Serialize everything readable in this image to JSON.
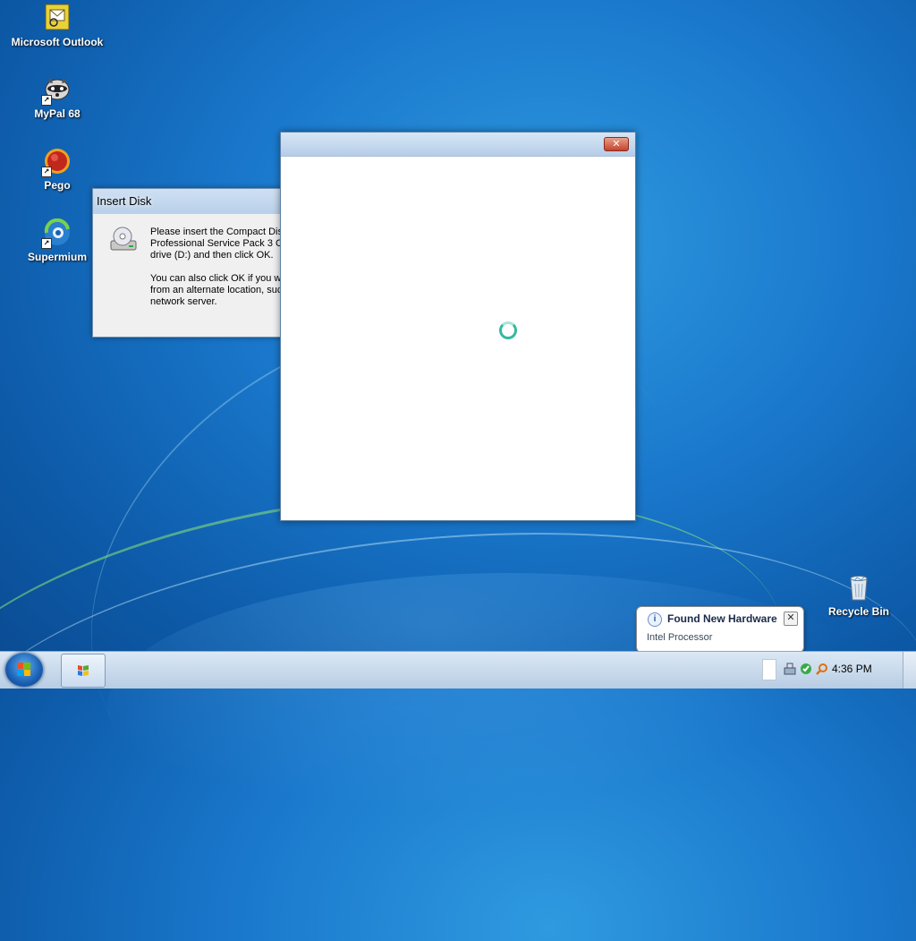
{
  "desktop": {
    "icons": [
      {
        "label": "Microsoft Outlook"
      },
      {
        "label": "MyPal 68"
      },
      {
        "label": "Pego"
      },
      {
        "label": "Supermium"
      }
    ],
    "recycle_bin_label": "Recycle Bin"
  },
  "insert_disk_dialog": {
    "title": "Insert Disk",
    "lines": [
      "Please insert the Compact Disc",
      "Professional Service Pack 3 C",
      "drive (D:) and then click OK.",
      "",
      "You can also click OK if you w",
      "from an alternate location, such",
      "network server."
    ]
  },
  "blank_window": {
    "close_icon": "close-icon"
  },
  "notification": {
    "title": "Found New Hardware",
    "text": "Intel Processor"
  },
  "taskbar": {
    "clock": "4:36 PM"
  }
}
